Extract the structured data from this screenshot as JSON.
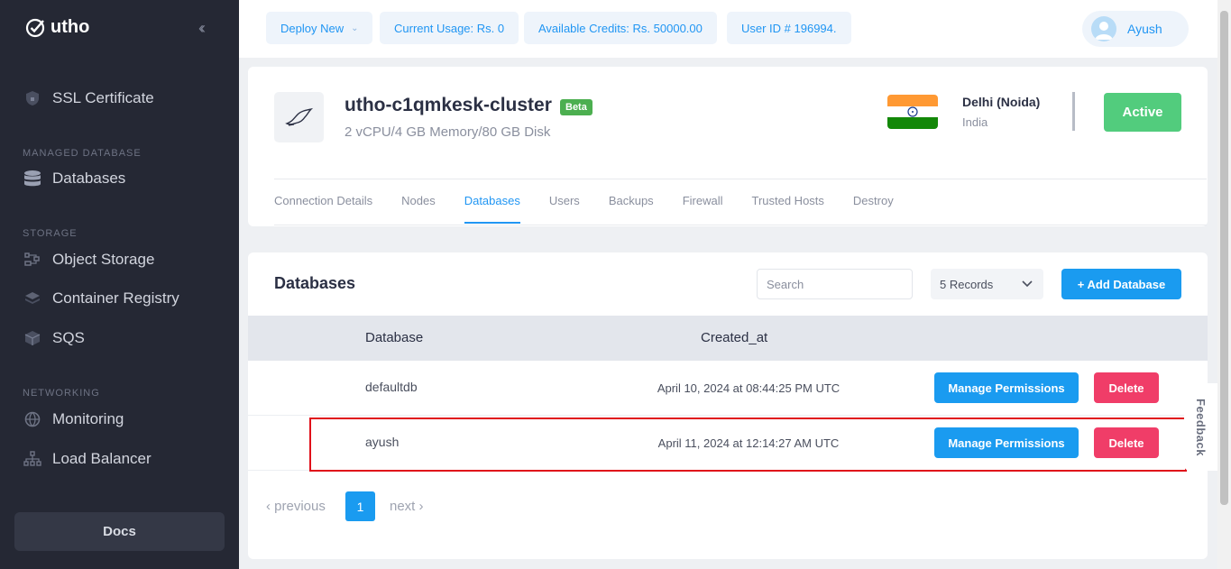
{
  "brand": {
    "name": "utho"
  },
  "sidebar": {
    "items": [
      {
        "label": "SSL Certificate",
        "icon": "shield-icon"
      },
      {
        "section": "MANAGED DATABASE"
      },
      {
        "label": "Databases",
        "icon": "database-icon"
      },
      {
        "section": "STORAGE"
      },
      {
        "label": "Object Storage",
        "icon": "object-storage-icon"
      },
      {
        "label": "Container Registry",
        "icon": "layers-icon"
      },
      {
        "label": "SQS",
        "icon": "cube-icon"
      },
      {
        "section": "NETWORKING"
      },
      {
        "label": "Monitoring",
        "icon": "globe-icon"
      },
      {
        "label": "Load Balancer",
        "icon": "network-icon"
      }
    ],
    "docs_label": "Docs"
  },
  "topbar": {
    "deploy_label": "Deploy New",
    "usage": "Current Usage: Rs. 0",
    "credits": "Available Credits: Rs. 50000.00",
    "user_id": "User ID # 196994.",
    "user_name": "Ayush"
  },
  "cluster": {
    "name": "utho-c1qmkesk-cluster",
    "badge": "Beta",
    "spec": "2 vCPU/4 GB Memory/80 GB Disk",
    "city": "Delhi (Noida)",
    "country": "India",
    "status": "Active",
    "flag_colors": [
      "#ff9933",
      "#ffffff",
      "#138808"
    ],
    "tabs": [
      "Connection Details",
      "Nodes",
      "Databases",
      "Users",
      "Backups",
      "Firewall",
      "Trusted Hosts",
      "Destroy"
    ],
    "active_tab": "Databases"
  },
  "databases": {
    "title": "Databases",
    "search_placeholder": "Search",
    "records_label": "5 Records",
    "add_label": "+ Add Database",
    "columns": [
      "Database",
      "Created_at"
    ],
    "rows": [
      {
        "name": "defaultdb",
        "created_at": "April 10, 2024 at 08:44:25 PM UTC",
        "perm_label": "Manage Permissions",
        "delete_label": "Delete"
      },
      {
        "name": "ayush",
        "created_at": "April 11, 2024 at 12:14:27 AM UTC",
        "perm_label": "Manage Permissions",
        "delete_label": "Delete"
      }
    ],
    "pagination": {
      "previous": "‹ previous",
      "page": "1",
      "next": "next ›"
    }
  },
  "feedback_label": "Feedback",
  "colors": {
    "accent": "#1a9bf0",
    "danger": "#f03d68",
    "success": "#52cc7d",
    "sidebar": "#252834"
  }
}
